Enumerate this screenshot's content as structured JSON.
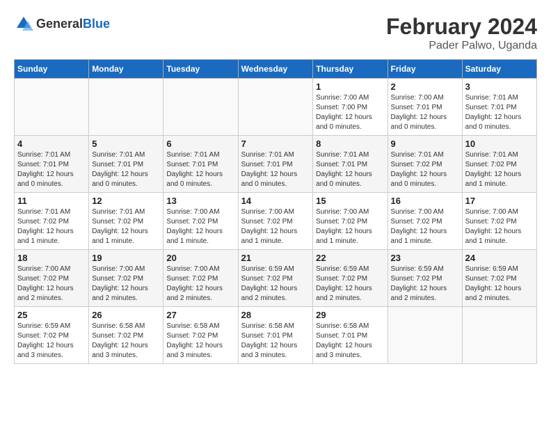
{
  "header": {
    "logo_general": "General",
    "logo_blue": "Blue",
    "title": "February 2024",
    "subtitle": "Pader Palwo, Uganda"
  },
  "days_of_week": [
    "Sunday",
    "Monday",
    "Tuesday",
    "Wednesday",
    "Thursday",
    "Friday",
    "Saturday"
  ],
  "weeks": [
    [
      {
        "day": "",
        "sunrise": "",
        "sunset": "",
        "daylight": ""
      },
      {
        "day": "",
        "sunrise": "",
        "sunset": "",
        "daylight": ""
      },
      {
        "day": "",
        "sunrise": "",
        "sunset": "",
        "daylight": ""
      },
      {
        "day": "",
        "sunrise": "",
        "sunset": "",
        "daylight": ""
      },
      {
        "day": "1",
        "sunrise": "Sunrise: 7:00 AM",
        "sunset": "Sunset: 7:00 PM",
        "daylight": "Daylight: 12 hours and 0 minutes."
      },
      {
        "day": "2",
        "sunrise": "Sunrise: 7:00 AM",
        "sunset": "Sunset: 7:01 PM",
        "daylight": "Daylight: 12 hours and 0 minutes."
      },
      {
        "day": "3",
        "sunrise": "Sunrise: 7:01 AM",
        "sunset": "Sunset: 7:01 PM",
        "daylight": "Daylight: 12 hours and 0 minutes."
      }
    ],
    [
      {
        "day": "4",
        "sunrise": "Sunrise: 7:01 AM",
        "sunset": "Sunset: 7:01 PM",
        "daylight": "Daylight: 12 hours and 0 minutes."
      },
      {
        "day": "5",
        "sunrise": "Sunrise: 7:01 AM",
        "sunset": "Sunset: 7:01 PM",
        "daylight": "Daylight: 12 hours and 0 minutes."
      },
      {
        "day": "6",
        "sunrise": "Sunrise: 7:01 AM",
        "sunset": "Sunset: 7:01 PM",
        "daylight": "Daylight: 12 hours and 0 minutes."
      },
      {
        "day": "7",
        "sunrise": "Sunrise: 7:01 AM",
        "sunset": "Sunset: 7:01 PM",
        "daylight": "Daylight: 12 hours and 0 minutes."
      },
      {
        "day": "8",
        "sunrise": "Sunrise: 7:01 AM",
        "sunset": "Sunset: 7:01 PM",
        "daylight": "Daylight: 12 hours and 0 minutes."
      },
      {
        "day": "9",
        "sunrise": "Sunrise: 7:01 AM",
        "sunset": "Sunset: 7:02 PM",
        "daylight": "Daylight: 12 hours and 0 minutes."
      },
      {
        "day": "10",
        "sunrise": "Sunrise: 7:01 AM",
        "sunset": "Sunset: 7:02 PM",
        "daylight": "Daylight: 12 hours and 1 minute."
      }
    ],
    [
      {
        "day": "11",
        "sunrise": "Sunrise: 7:01 AM",
        "sunset": "Sunset: 7:02 PM",
        "daylight": "Daylight: 12 hours and 1 minute."
      },
      {
        "day": "12",
        "sunrise": "Sunrise: 7:01 AM",
        "sunset": "Sunset: 7:02 PM",
        "daylight": "Daylight: 12 hours and 1 minute."
      },
      {
        "day": "13",
        "sunrise": "Sunrise: 7:00 AM",
        "sunset": "Sunset: 7:02 PM",
        "daylight": "Daylight: 12 hours and 1 minute."
      },
      {
        "day": "14",
        "sunrise": "Sunrise: 7:00 AM",
        "sunset": "Sunset: 7:02 PM",
        "daylight": "Daylight: 12 hours and 1 minute."
      },
      {
        "day": "15",
        "sunrise": "Sunrise: 7:00 AM",
        "sunset": "Sunset: 7:02 PM",
        "daylight": "Daylight: 12 hours and 1 minute."
      },
      {
        "day": "16",
        "sunrise": "Sunrise: 7:00 AM",
        "sunset": "Sunset: 7:02 PM",
        "daylight": "Daylight: 12 hours and 1 minute."
      },
      {
        "day": "17",
        "sunrise": "Sunrise: 7:00 AM",
        "sunset": "Sunset: 7:02 PM",
        "daylight": "Daylight: 12 hours and 1 minute."
      }
    ],
    [
      {
        "day": "18",
        "sunrise": "Sunrise: 7:00 AM",
        "sunset": "Sunset: 7:02 PM",
        "daylight": "Daylight: 12 hours and 2 minutes."
      },
      {
        "day": "19",
        "sunrise": "Sunrise: 7:00 AM",
        "sunset": "Sunset: 7:02 PM",
        "daylight": "Daylight: 12 hours and 2 minutes."
      },
      {
        "day": "20",
        "sunrise": "Sunrise: 7:00 AM",
        "sunset": "Sunset: 7:02 PM",
        "daylight": "Daylight: 12 hours and 2 minutes."
      },
      {
        "day": "21",
        "sunrise": "Sunrise: 6:59 AM",
        "sunset": "Sunset: 7:02 PM",
        "daylight": "Daylight: 12 hours and 2 minutes."
      },
      {
        "day": "22",
        "sunrise": "Sunrise: 6:59 AM",
        "sunset": "Sunset: 7:02 PM",
        "daylight": "Daylight: 12 hours and 2 minutes."
      },
      {
        "day": "23",
        "sunrise": "Sunrise: 6:59 AM",
        "sunset": "Sunset: 7:02 PM",
        "daylight": "Daylight: 12 hours and 2 minutes."
      },
      {
        "day": "24",
        "sunrise": "Sunrise: 6:59 AM",
        "sunset": "Sunset: 7:02 PM",
        "daylight": "Daylight: 12 hours and 2 minutes."
      }
    ],
    [
      {
        "day": "25",
        "sunrise": "Sunrise: 6:59 AM",
        "sunset": "Sunset: 7:02 PM",
        "daylight": "Daylight: 12 hours and 3 minutes."
      },
      {
        "day": "26",
        "sunrise": "Sunrise: 6:58 AM",
        "sunset": "Sunset: 7:02 PM",
        "daylight": "Daylight: 12 hours and 3 minutes."
      },
      {
        "day": "27",
        "sunrise": "Sunrise: 6:58 AM",
        "sunset": "Sunset: 7:02 PM",
        "daylight": "Daylight: 12 hours and 3 minutes."
      },
      {
        "day": "28",
        "sunrise": "Sunrise: 6:58 AM",
        "sunset": "Sunset: 7:01 PM",
        "daylight": "Daylight: 12 hours and 3 minutes."
      },
      {
        "day": "29",
        "sunrise": "Sunrise: 6:58 AM",
        "sunset": "Sunset: 7:01 PM",
        "daylight": "Daylight: 12 hours and 3 minutes."
      },
      {
        "day": "",
        "sunrise": "",
        "sunset": "",
        "daylight": ""
      },
      {
        "day": "",
        "sunrise": "",
        "sunset": "",
        "daylight": ""
      }
    ]
  ]
}
